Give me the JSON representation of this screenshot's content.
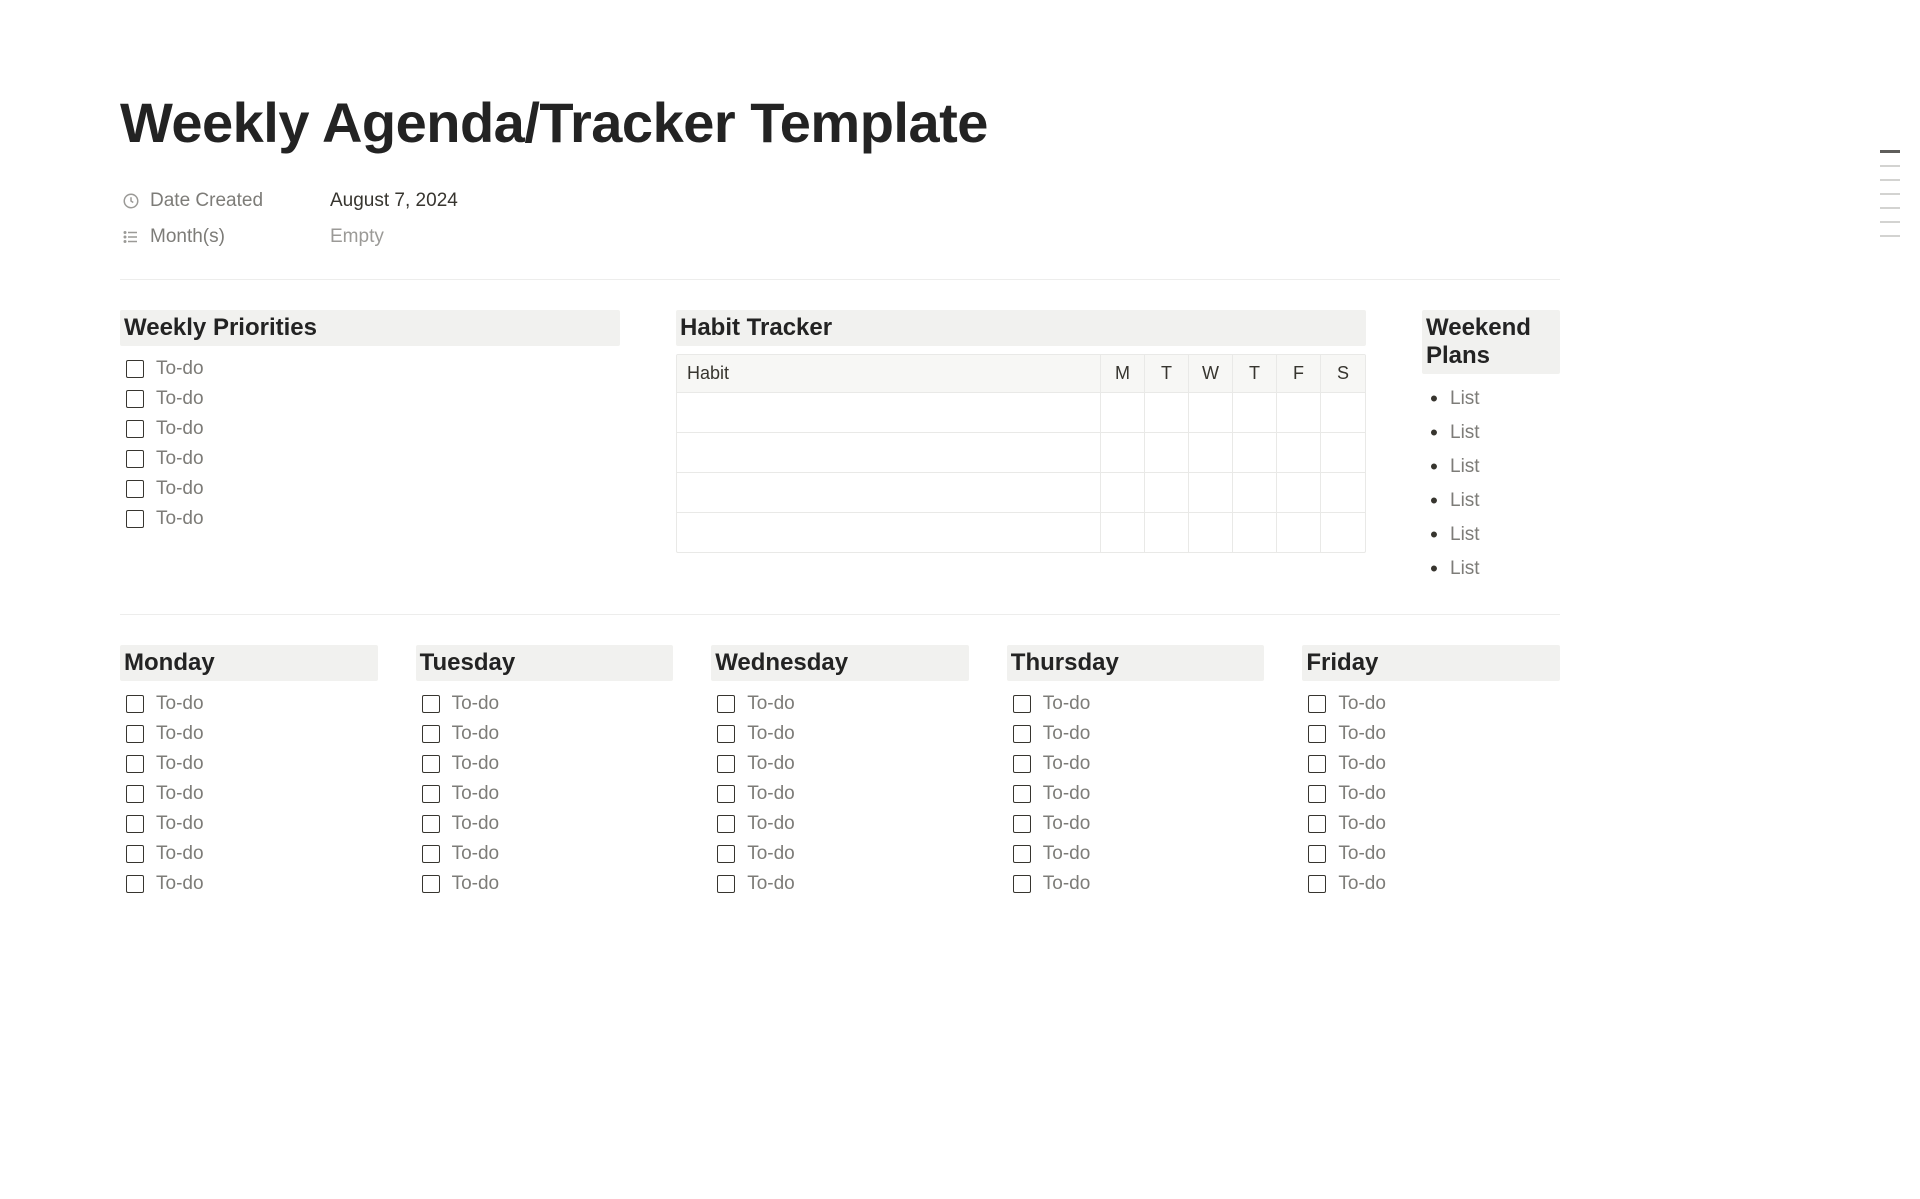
{
  "title": "Weekly Agenda/Tracker Template",
  "properties": {
    "dateCreated": {
      "label": "Date Created",
      "value": "August 7, 2024"
    },
    "months": {
      "label": "Month(s)",
      "value": "Empty"
    }
  },
  "priorities": {
    "heading": "Weekly Priorities",
    "items": [
      "To-do",
      "To-do",
      "To-do",
      "To-do",
      "To-do",
      "To-do"
    ]
  },
  "habitTracker": {
    "heading": "Habit Tracker",
    "firstCol": "Habit",
    "days": [
      "M",
      "T",
      "W",
      "T",
      "F",
      "S"
    ],
    "rows": 4
  },
  "weekend": {
    "heading": "Weekend Plans",
    "items": [
      "List",
      "List",
      "List",
      "List",
      "List",
      "List"
    ]
  },
  "days": [
    {
      "heading": "Monday",
      "items": [
        "To-do",
        "To-do",
        "To-do",
        "To-do",
        "To-do",
        "To-do",
        "To-do"
      ]
    },
    {
      "heading": "Tuesday",
      "items": [
        "To-do",
        "To-do",
        "To-do",
        "To-do",
        "To-do",
        "To-do",
        "To-do"
      ]
    },
    {
      "heading": "Wednesday",
      "items": [
        "To-do",
        "To-do",
        "To-do",
        "To-do",
        "To-do",
        "To-do",
        "To-do"
      ]
    },
    {
      "heading": "Thursday",
      "items": [
        "To-do",
        "To-do",
        "To-do",
        "To-do",
        "To-do",
        "To-do",
        "To-do"
      ]
    },
    {
      "heading": "Friday",
      "items": [
        "To-do",
        "To-do",
        "To-do",
        "To-do",
        "To-do",
        "To-do",
        "To-do"
      ]
    }
  ]
}
